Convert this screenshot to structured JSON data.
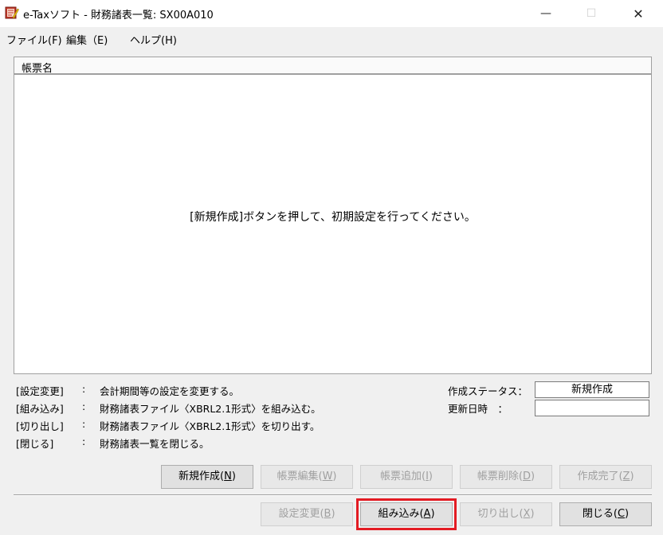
{
  "window": {
    "title": "e-Taxソフト - 財務諸表一覧: SX00A010",
    "minimize": "—",
    "maximize": "☐",
    "close": "✕"
  },
  "menu": [
    {
      "label": "ファイル(F)"
    },
    {
      "label": "編集（E)"
    },
    {
      "label": "ヘルプ(H)"
    }
  ],
  "list": {
    "column_header": "帳票名",
    "empty_message": "[新規作成]ボタンを押して、初期設定を行ってください。"
  },
  "help": [
    {
      "key": "[設定変更]",
      "colon": ":",
      "desc": "会計期間等の設定を変更する。"
    },
    {
      "key": "[組み込み]",
      "colon": ":",
      "desc": "財務諸表ファイル〈XBRL2.1形式〉を組み込む。"
    },
    {
      "key": "[切り出し]",
      "colon": ":",
      "desc": "財務諸表ファイル〈XBRL2.1形式〉を切り出す。"
    },
    {
      "key": "[閉じる]",
      "colon": ":",
      "desc": "財務諸表一覧を閉じる。"
    }
  ],
  "status": {
    "creation_label": "作成ステータス：",
    "creation_value": "新規作成",
    "updated_label": "更新日時　：",
    "updated_value": ""
  },
  "buttons_row1": {
    "new_text": "新規作成(",
    "new_acc": "N",
    "new_end": ")",
    "edit_text": "帳票編集(",
    "edit_acc": "W",
    "edit_end": ")",
    "add_text": "帳票追加(",
    "add_acc": "I",
    "add_end": ")",
    "delete_text": "帳票削除(",
    "delete_acc": "D",
    "delete_end": ")",
    "complete_text": "作成完了(",
    "complete_acc": "Z",
    "complete_end": ")"
  },
  "buttons_row2": {
    "settings_text": "設定変更(",
    "settings_acc": "B",
    "settings_end": ")",
    "import_text": "組み込み(",
    "import_acc": "A",
    "import_end": ")",
    "export_text": "切り出し(",
    "export_acc": "X",
    "export_end": ")",
    "close_text": "閉じる(",
    "close_acc": "C",
    "close_end": ")"
  },
  "colors": {
    "highlight": "#e31b23",
    "window_bg": "#f0f0f0"
  }
}
